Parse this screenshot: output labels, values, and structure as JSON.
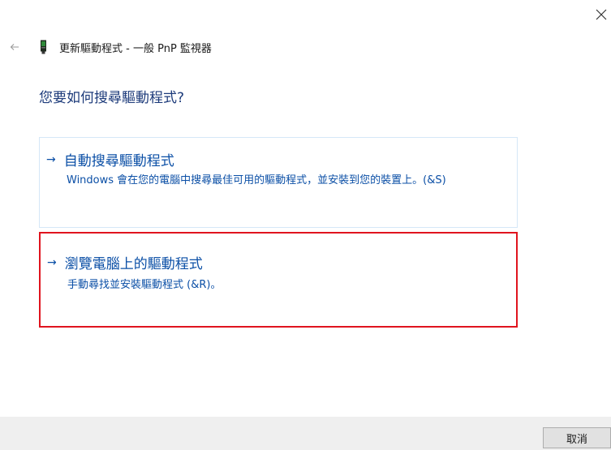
{
  "window": {
    "title": "更新驅動程式 - 一般 PnP 監視器",
    "close_icon": "close-icon",
    "back_icon": "back-arrow-icon",
    "device_icon": "monitor-device-icon"
  },
  "main": {
    "heading": "您要如何搜尋驅動程式?",
    "options": [
      {
        "arrow": "→",
        "title": "自動搜尋驅動程式",
        "description": "Windows 會在您的電腦中搜尋最佳可用的驅動程式，並安裝到您的裝置上。(&S)"
      },
      {
        "arrow": "→",
        "title": "瀏覽電腦上的驅動程式",
        "description": "手動尋找並安裝驅動程式 (&R)。",
        "highlighted": true
      }
    ]
  },
  "footer": {
    "cancel_label": "取消"
  },
  "colors": {
    "heading": "#1c3a7a",
    "link": "#0b4fa6",
    "highlight_border": "#e0141e",
    "option_border": "#d5e7f7",
    "footer_bg": "#efefef"
  }
}
